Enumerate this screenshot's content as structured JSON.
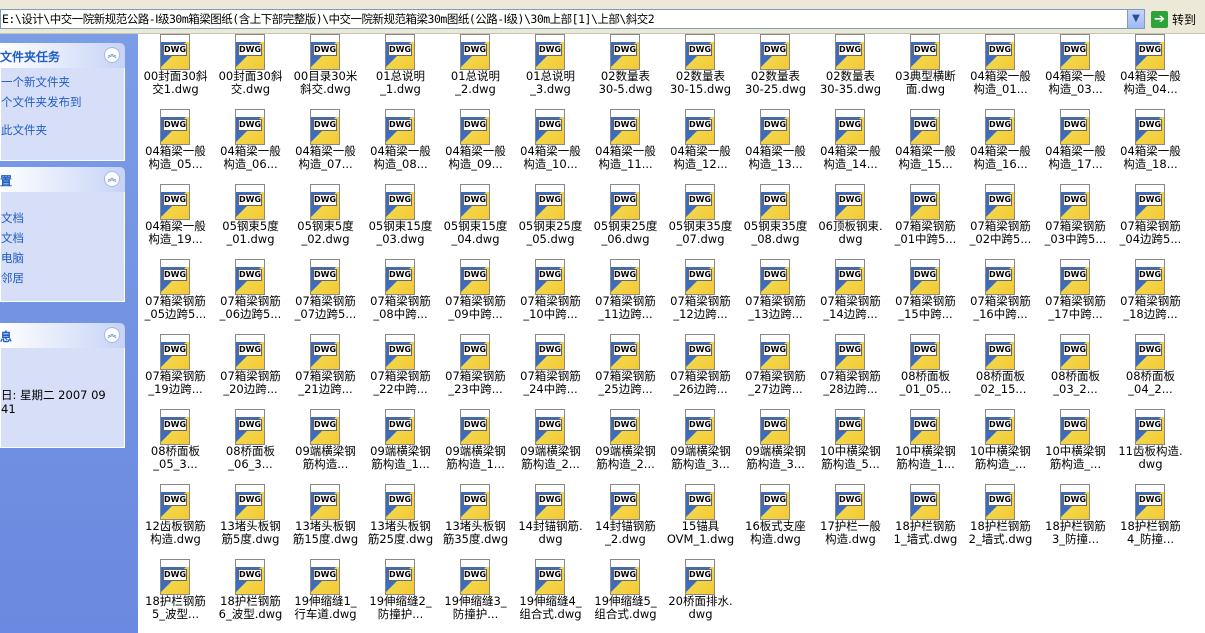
{
  "address": {
    "path": "E:\\设计\\中交一院新规范公路-Ⅰ级30m箱梁图纸(含上下部完整版)\\中交一院新规范箱梁30m图纸(公路-Ⅰ级)\\30m上部[1]\\上部\\斜交2",
    "go_label": "转到"
  },
  "sidebar": {
    "tasks_title": "文件夹任务",
    "tasks": [
      "一个新文件夹",
      "个文件夹发布到",
      "此文件夹"
    ],
    "places_title": "置",
    "places": [
      "文档",
      "文档",
      "电脑",
      "邻居"
    ],
    "details_title": "息",
    "details": [
      "日: 星期二 2007 09",
      "41"
    ]
  },
  "icon_label": "DWG",
  "files": [
    [
      "00封面30斜",
      "交1.dwg"
    ],
    [
      "00封面30斜",
      "交.dwg"
    ],
    [
      "00目录30米",
      "斜交.dwg"
    ],
    [
      "01总说明",
      "_1.dwg"
    ],
    [
      "01总说明",
      "_2.dwg"
    ],
    [
      "01总说明",
      "_3.dwg"
    ],
    [
      "02数量表",
      "30-5.dwg"
    ],
    [
      "02数量表",
      "30-15.dwg"
    ],
    [
      "02数量表",
      "30-25.dwg"
    ],
    [
      "02数量表",
      "30-35.dwg"
    ],
    [
      "03典型横断",
      "面.dwg"
    ],
    [
      "04箱梁一般",
      "构造_01..."
    ],
    [
      "04箱梁一般",
      "构造_03..."
    ],
    [
      "04箱梁一般",
      "构造_04..."
    ],
    [
      "04箱梁一般",
      "构造_05..."
    ],
    [
      "04箱梁一般",
      "构造_06..."
    ],
    [
      "04箱梁一般",
      "构造_07..."
    ],
    [
      "04箱梁一般",
      "构造_08..."
    ],
    [
      "04箱梁一般",
      "构造_09..."
    ],
    [
      "04箱梁一般",
      "构造_10..."
    ],
    [
      "04箱梁一般",
      "构造_11..."
    ],
    [
      "04箱梁一般",
      "构造_12..."
    ],
    [
      "04箱梁一般",
      "构造_13..."
    ],
    [
      "04箱梁一般",
      "构造_14..."
    ],
    [
      "04箱梁一般",
      "构造_15..."
    ],
    [
      "04箱梁一般",
      "构造_16..."
    ],
    [
      "04箱梁一般",
      "构造_17..."
    ],
    [
      "04箱梁一般",
      "构造_18..."
    ],
    [
      "04箱梁一般",
      "构造_19..."
    ],
    [
      "05钢束5度",
      "_01.dwg"
    ],
    [
      "05钢束5度",
      "_02.dwg"
    ],
    [
      "05钢束15度",
      "_03.dwg"
    ],
    [
      "05钢束15度",
      "_04.dwg"
    ],
    [
      "05钢束25度",
      "_05.dwg"
    ],
    [
      "05钢束25度",
      "_06.dwg"
    ],
    [
      "05钢束35度",
      "_07.dwg"
    ],
    [
      "05钢束35度",
      "_08.dwg"
    ],
    [
      "06顶板钢束.",
      "dwg"
    ],
    [
      "07箱梁钢筋",
      "_01中跨5..."
    ],
    [
      "07箱梁钢筋",
      "_02中跨5..."
    ],
    [
      "07箱梁钢筋",
      "_03中跨5..."
    ],
    [
      "07箱梁钢筋",
      "_04边跨5..."
    ],
    [
      "07箱梁钢筋",
      "_05边跨5..."
    ],
    [
      "07箱梁钢筋",
      "_06边跨5..."
    ],
    [
      "07箱梁钢筋",
      "_07边跨5..."
    ],
    [
      "07箱梁钢筋",
      "_08中跨..."
    ],
    [
      "07箱梁钢筋",
      "_09中跨..."
    ],
    [
      "07箱梁钢筋",
      "_10中跨..."
    ],
    [
      "07箱梁钢筋",
      "_11边跨..."
    ],
    [
      "07箱梁钢筋",
      "_12边跨..."
    ],
    [
      "07箱梁钢筋",
      "_13边跨..."
    ],
    [
      "07箱梁钢筋",
      "_14边跨..."
    ],
    [
      "07箱梁钢筋",
      "_15中跨..."
    ],
    [
      "07箱梁钢筋",
      "_16中跨..."
    ],
    [
      "07箱梁钢筋",
      "_17中跨..."
    ],
    [
      "07箱梁钢筋",
      "_18边跨..."
    ],
    [
      "07箱梁钢筋",
      "_19边跨..."
    ],
    [
      "07箱梁钢筋",
      "_20边跨..."
    ],
    [
      "07箱梁钢筋",
      "_21边跨..."
    ],
    [
      "07箱梁钢筋",
      "_22中跨..."
    ],
    [
      "07箱梁钢筋",
      "_23中跨..."
    ],
    [
      "07箱梁钢筋",
      "_24中跨..."
    ],
    [
      "07箱梁钢筋",
      "_25边跨..."
    ],
    [
      "07箱梁钢筋",
      "_26边跨..."
    ],
    [
      "07箱梁钢筋",
      "_27边跨..."
    ],
    [
      "07箱梁钢筋",
      "_28边跨..."
    ],
    [
      "08桥面板",
      "_01_05..."
    ],
    [
      "08桥面板",
      "_02_15..."
    ],
    [
      "08桥面板",
      "_03_2..."
    ],
    [
      "08桥面板",
      "_04_2..."
    ],
    [
      "08桥面板",
      "_05_3..."
    ],
    [
      "08桥面板",
      "_06_3..."
    ],
    [
      "09端横梁钢",
      "筋构造..."
    ],
    [
      "09端横梁钢",
      "筋构造_1..."
    ],
    [
      "09端横梁钢",
      "筋构造_1..."
    ],
    [
      "09端横梁钢",
      "筋构造_2..."
    ],
    [
      "09端横梁钢",
      "筋构造_2..."
    ],
    [
      "09端横梁钢",
      "筋构造_3..."
    ],
    [
      "09端横梁钢",
      "筋构造_3..."
    ],
    [
      "10中横梁钢",
      "筋构造_5..."
    ],
    [
      "10中横梁钢",
      "筋构造_1..."
    ],
    [
      "10中横梁钢",
      "筋构造_..."
    ],
    [
      "10中横梁钢",
      "筋构造_..."
    ],
    [
      "11齿板构造.",
      "dwg"
    ],
    [
      "12齿板钢筋",
      "构造.dwg"
    ],
    [
      "13堵头板钢",
      "筋5度.dwg"
    ],
    [
      "13堵头板钢",
      "筋15度.dwg"
    ],
    [
      "13堵头板钢",
      "筋25度.dwg"
    ],
    [
      "13堵头板钢",
      "筋35度.dwg"
    ],
    [
      "14封锚钢筋.",
      "dwg"
    ],
    [
      "14封锚钢筋",
      "_2.dwg"
    ],
    [
      "15锚具",
      "OVM_1.dwg"
    ],
    [
      "16板式支座",
      "构造.dwg"
    ],
    [
      "17护栏一般",
      "构造.dwg"
    ],
    [
      "18护栏钢筋",
      "1_墙式.dwg"
    ],
    [
      "18护栏钢筋",
      "2_墙式.dwg"
    ],
    [
      "18护栏钢筋",
      "3_防撞..."
    ],
    [
      "18护栏钢筋",
      "4_防撞..."
    ],
    [
      "18护栏钢筋",
      "5_波型..."
    ],
    [
      "18护栏钢筋",
      "6_波型.dwg"
    ],
    [
      "19伸缩缝1_",
      "行车道.dwg"
    ],
    [
      "19伸缩缝2_",
      "防撞护..."
    ],
    [
      "19伸缩缝3_",
      "防撞护..."
    ],
    [
      "19伸缩缝4_",
      "组合式.dwg"
    ],
    [
      "19伸缩缝5_",
      "组合式.dwg"
    ],
    [
      "20桥面排水.",
      "dwg"
    ]
  ]
}
